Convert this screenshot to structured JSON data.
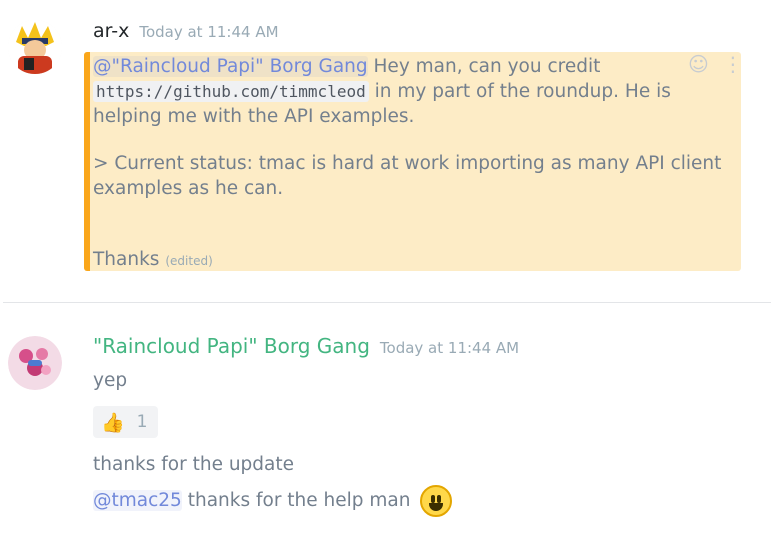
{
  "messages": [
    {
      "author": "ar-x",
      "timestamp": "Today at 11:44 AM",
      "mention": "@\"Raincloud Papi\" Borg Gang",
      "text_a": " Hey man, can you credit",
      "code": "https://github.com/timmcleod",
      "text_b": " in my part of the roundup. He is",
      "text_c": "helping me with the API examples.",
      "quote_line1": "> Current status: tmac is hard at work importing as many API client",
      "quote_line2": "examples as he can.",
      "thanks": "Thanks",
      "edited": "(edited)"
    },
    {
      "author": "\"Raincloud Papi\" Borg Gang",
      "timestamp": "Today at 11:44 AM",
      "line1": "yep",
      "reaction": {
        "emoji": "👍",
        "count": "1"
      },
      "line2": "thanks for the update",
      "mention": "@tmac25",
      "line3": " thanks for the help man"
    }
  ],
  "colors": {
    "highlight_bg": "#fdecc6",
    "highlight_border": "#faa61a",
    "mention": "#7289da",
    "username_green": "#43b581"
  },
  "icons": [
    "add-reaction-icon",
    "more-options-icon",
    "smiley-emoji-icon"
  ]
}
